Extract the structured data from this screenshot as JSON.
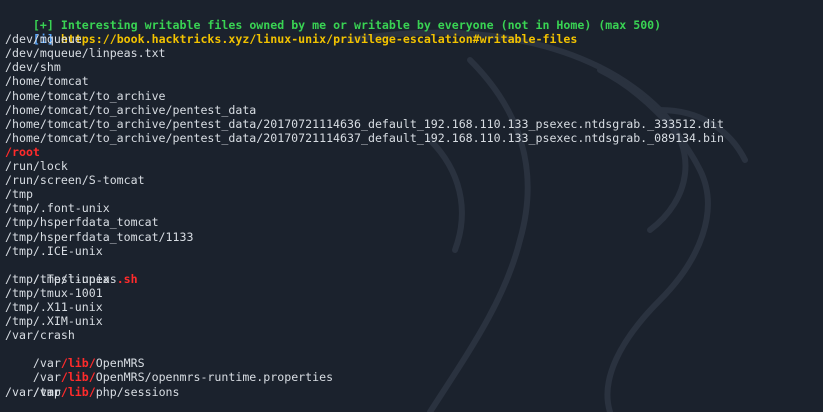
{
  "header": {
    "line1_tag": "[+]",
    "line1_text": " Interesting writable files owned by me or writable by everyone (not in Home) (max 500)",
    "line2_tag": "[i]",
    "line2_text": " https://book.hacktricks.xyz/linux-unix/privilege-escalation#writable-files"
  },
  "paths": {
    "p1": "/dev/mqueue",
    "p2": "/dev/mqueue/linpeas.txt",
    "p3": "/dev/shm",
    "p4": "/home/tomcat",
    "p5": "/home/tomcat/to_archive",
    "p6": "/home/tomcat/to_archive/pentest_data",
    "p7": "/home/tomcat/to_archive/pentest_data/20170721114636_default_192.168.110.133_psexec.ntdsgrab._333512.dit",
    "p8": "/home/tomcat/to_archive/pentest_data/20170721114637_default_192.168.110.133_psexec.ntdsgrab._089134.bin",
    "p9": "/root",
    "p10": "/run/lock",
    "p11": "/run/screen/S-tomcat",
    "p12": "/tmp",
    "p13": "/tmp/.font-unix",
    "p14": "/tmp/hsperfdata_tomcat",
    "p15": "/tmp/hsperfdata_tomcat/1133",
    "p16": "/tmp/.ICE-unix",
    "p17_a": "/tmp/linpeas",
    "p17_b": ".sh",
    "p18": "/tmp/.Test-unix",
    "p19": "/tmp/tmux-1001",
    "p20": "/tmp/.X11-unix",
    "p21": "/tmp/.XIM-unix",
    "p22": "/var/crash",
    "p23_a": "/var",
    "p23_b": "/lib/",
    "p23_c": "OpenMRS",
    "p24_a": "/var",
    "p24_b": "/lib/",
    "p24_c": "OpenMRS/openmrs-runtime.properties",
    "p25_a": "/var",
    "p25_b": "/lib/",
    "p25_c": "php/sessions",
    "p26": "/var/tmp"
  },
  "colors": {
    "background": "#1b222d",
    "text": "#d8dde3",
    "green": "#39d353",
    "blue": "#5aa8ff",
    "yellow": "#f2c200",
    "red": "#ff2b2b"
  }
}
